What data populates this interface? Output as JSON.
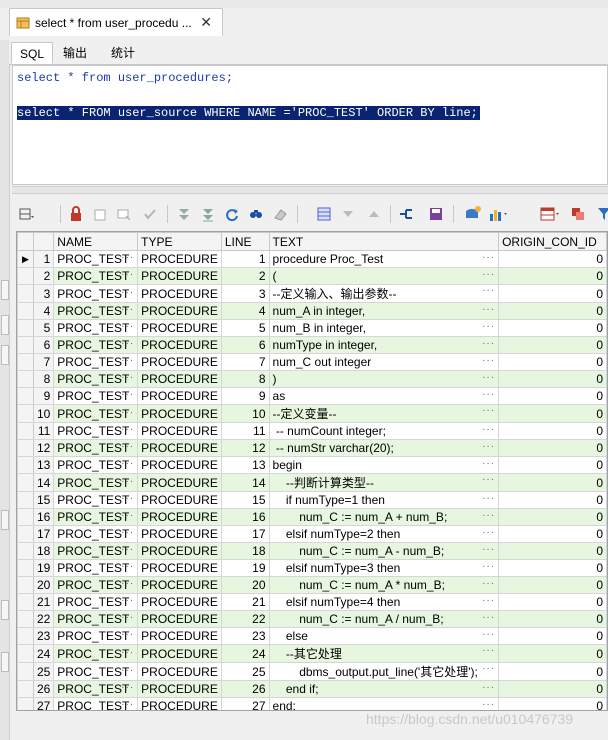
{
  "colors": {
    "accent": "#0a2472",
    "row_alt": "#e6f6df",
    "keyword": "#1a3cb0"
  },
  "doc_tab": {
    "title": "select * from user_procedu ...",
    "icon": "database-table-icon",
    "close": "✕"
  },
  "sub_tabs": [
    {
      "label": "SQL"
    },
    {
      "label": "输出"
    },
    {
      "label": "统计"
    }
  ],
  "editor": {
    "line1": "select * from user_procedures;",
    "line3": "select * FROM user_source WHERE NAME ='PROC_TEST' ORDER BY line;"
  },
  "grid": {
    "columns": [
      "NAME",
      "TYPE",
      "LINE",
      "TEXT",
      "ORIGIN_CON_ID"
    ],
    "rows": [
      [
        "1",
        "PROC_TEST",
        "PROCEDURE",
        "1",
        "procedure Proc_Test",
        "0"
      ],
      [
        "2",
        "PROC_TEST",
        "PROCEDURE",
        "2",
        "(",
        "0"
      ],
      [
        "3",
        "PROC_TEST",
        "PROCEDURE",
        "3",
        "--定义输入、输出参数--",
        "0"
      ],
      [
        "4",
        "PROC_TEST",
        "PROCEDURE",
        "4",
        "num_A in integer,",
        "0"
      ],
      [
        "5",
        "PROC_TEST",
        "PROCEDURE",
        "5",
        "num_B in integer,",
        "0"
      ],
      [
        "6",
        "PROC_TEST",
        "PROCEDURE",
        "6",
        "numType in integer,",
        "0"
      ],
      [
        "7",
        "PROC_TEST",
        "PROCEDURE",
        "7",
        "num_C out integer",
        "0"
      ],
      [
        "8",
        "PROC_TEST",
        "PROCEDURE",
        "8",
        ")",
        "0"
      ],
      [
        "9",
        "PROC_TEST",
        "PROCEDURE",
        "9",
        "as",
        "0"
      ],
      [
        "10",
        "PROC_TEST",
        "PROCEDURE",
        "10",
        "--定义变量--",
        "0"
      ],
      [
        "11",
        "PROC_TEST",
        "PROCEDURE",
        "11",
        " -- numCount integer;",
        "0"
      ],
      [
        "12",
        "PROC_TEST",
        "PROCEDURE",
        "12",
        " -- numStr varchar(20);",
        "0"
      ],
      [
        "13",
        "PROC_TEST",
        "PROCEDURE",
        "13",
        "begin",
        "0"
      ],
      [
        "14",
        "PROC_TEST",
        "PROCEDURE",
        "14",
        "    --判断计算类型--",
        "0"
      ],
      [
        "15",
        "PROC_TEST",
        "PROCEDURE",
        "15",
        "    if numType=1 then",
        "0"
      ],
      [
        "16",
        "PROC_TEST",
        "PROCEDURE",
        "16",
        "        num_C := num_A + num_B;",
        "0"
      ],
      [
        "17",
        "PROC_TEST",
        "PROCEDURE",
        "17",
        "    elsif numType=2 then",
        "0"
      ],
      [
        "18",
        "PROC_TEST",
        "PROCEDURE",
        "18",
        "        num_C := num_A - num_B;",
        "0"
      ],
      [
        "19",
        "PROC_TEST",
        "PROCEDURE",
        "19",
        "    elsif numType=3 then",
        "0"
      ],
      [
        "20",
        "PROC_TEST",
        "PROCEDURE",
        "20",
        "        num_C := num_A * num_B;",
        "0"
      ],
      [
        "21",
        "PROC_TEST",
        "PROCEDURE",
        "21",
        "    elsif numType=4 then",
        "0"
      ],
      [
        "22",
        "PROC_TEST",
        "PROCEDURE",
        "22",
        "        num_C := num_A / num_B;",
        "0"
      ],
      [
        "23",
        "PROC_TEST",
        "PROCEDURE",
        "23",
        "    else",
        "0"
      ],
      [
        "24",
        "PROC_TEST",
        "PROCEDURE",
        "24",
        "    --其它处理",
        "0"
      ],
      [
        "25",
        "PROC_TEST",
        "PROCEDURE",
        "25",
        "        dbms_output.put_line('其它处理');",
        "0"
      ],
      [
        "26",
        "PROC_TEST",
        "PROCEDURE",
        "26",
        "    end if;",
        "0"
      ],
      [
        "27",
        "PROC_TEST",
        "PROCEDURE",
        "27",
        "end;",
        "0"
      ]
    ],
    "selected_row_marker": "▶",
    "cell_button": "···"
  },
  "toolbar": {
    "icons": [
      "grid-options-icon",
      "lock-icon",
      "new-record-icon",
      "delete-record-icon",
      "post-changes-icon",
      "filter-down-icon",
      "fetch-all-icon",
      "refresh-icon",
      "find-icon",
      "clear-icon",
      "layout-icon",
      "sort-desc-icon",
      "sort-asc-icon",
      "link-icon",
      "save-icon",
      "query-builder-icon",
      "chart-icon",
      "table-view-icon",
      "export-icon",
      "filter-icon"
    ]
  },
  "watermark": "https://blog.csdn.net/u010476739"
}
